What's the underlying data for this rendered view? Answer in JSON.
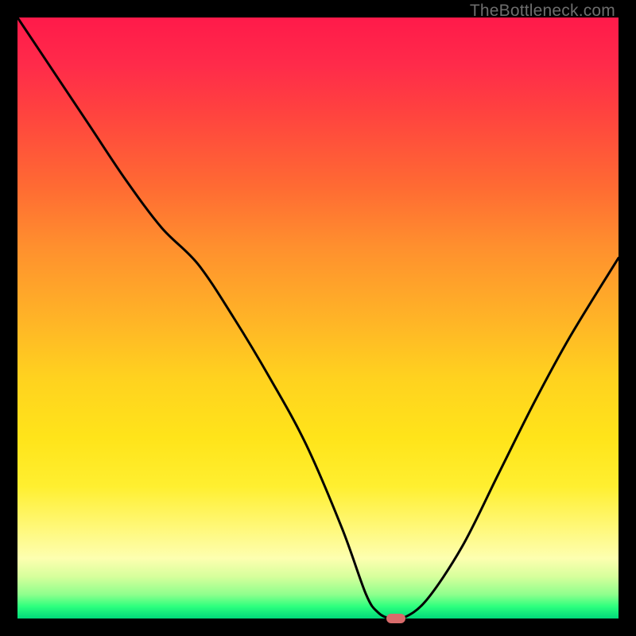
{
  "watermark": "TheBottleneck.com",
  "colors": {
    "frame": "#000000",
    "curve": "#000000",
    "marker": "#d86b6b"
  },
  "chart_data": {
    "type": "line",
    "title": "",
    "xlabel": "",
    "ylabel": "",
    "xlim": [
      0,
      100
    ],
    "ylim": [
      0,
      100
    ],
    "grid": false,
    "legend": false,
    "series": [
      {
        "name": "bottleneck-curve",
        "x": [
          0,
          6,
          12,
          18,
          24,
          30,
          36,
          42,
          48,
          54,
          58,
          60,
          62,
          64,
          68,
          74,
          80,
          86,
          92,
          100
        ],
        "y": [
          100,
          91,
          82,
          73,
          65,
          59,
          50,
          40,
          29,
          15,
          4,
          1,
          0,
          0,
          3,
          12,
          24,
          36,
          47,
          60
        ]
      }
    ],
    "marker": {
      "x": 63,
      "y": 0
    },
    "background_gradient": {
      "top": "#ff1a4a",
      "mid": "#ffd21f",
      "bottom": "#00d97a"
    }
  }
}
